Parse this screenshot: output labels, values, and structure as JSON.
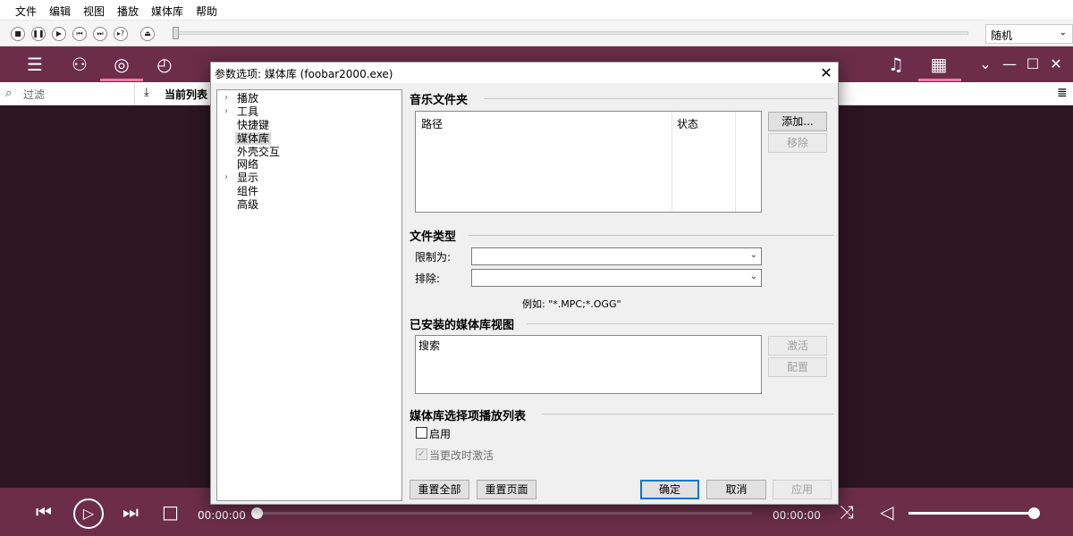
{
  "menu": [
    "文件",
    "编辑",
    "视图",
    "播放",
    "媒体库",
    "帮助"
  ],
  "toolbar": {
    "buttons": [
      "stop-icon",
      "pause-icon",
      "play-icon",
      "prev-icon",
      "next-icon",
      "random-icon",
      "open-icon"
    ],
    "order_value": "随机"
  },
  "nav": {
    "left_icons": [
      "list-icon",
      "user-icon",
      "disc-icon",
      "gauge-icon",
      "circle-icon"
    ],
    "right_icons": [
      "music-note-icon",
      "calendar-icon",
      "chevron-down-icon",
      "minimize-icon",
      "maximize-icon",
      "close-icon"
    ]
  },
  "subbar": {
    "filter_placeholder": "过滤",
    "current_playlist": "当前列表"
  },
  "dialog": {
    "title": "参数选项: 媒体库 (foobar2000.exe)",
    "close": "✕",
    "tree": [
      {
        "label": "播放",
        "expandable": true
      },
      {
        "label": "工具",
        "expandable": true
      },
      {
        "label": "快捷键",
        "expandable": false
      },
      {
        "label": "媒体库",
        "expandable": false,
        "selected": true
      },
      {
        "label": "外壳交互",
        "expandable": false
      },
      {
        "label": "网络",
        "expandable": false
      },
      {
        "label": "显示",
        "expandable": true
      },
      {
        "label": "组件",
        "expandable": false
      },
      {
        "label": "高级",
        "expandable": false
      }
    ],
    "music_folders": {
      "title": "音乐文件夹",
      "col_path": "路径",
      "col_status": "状态",
      "add": "添加...",
      "remove": "移除"
    },
    "file_types": {
      "title": "文件类型",
      "restrict_label": "限制为:",
      "exclude_label": "排除:",
      "restrict_value": "",
      "exclude_value": "",
      "example": "例如: \"*.MPC;*.OGG\""
    },
    "views": {
      "title": "已安装的媒体库视图",
      "items": [
        "搜索"
      ],
      "activate": "激活",
      "configure": "配置"
    },
    "playlist": {
      "title": "媒体库选择项播放列表",
      "enable": "启用",
      "activate_on_change": "当更改时激活"
    },
    "buttons": {
      "reset_all": "重置全部",
      "reset_page": "重置页面",
      "ok": "确定",
      "cancel": "取消",
      "apply": "应用"
    }
  },
  "player": {
    "time_left": "00:00:00",
    "time_right": "00:00:00",
    "progress": 0,
    "volume": 1.0
  },
  "colors": {
    "accent": "#6b2d48",
    "highlight": "#ef7ca6",
    "background": "#2d1522"
  }
}
